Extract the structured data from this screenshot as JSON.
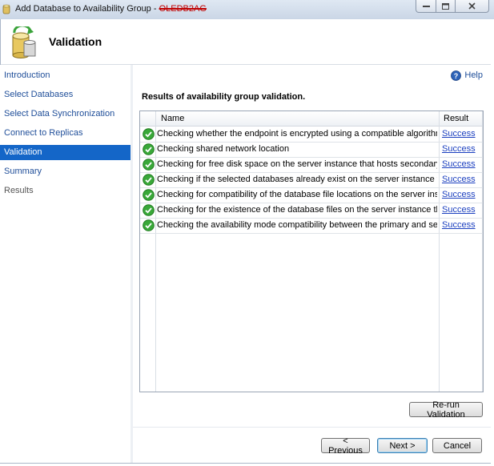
{
  "window": {
    "title": "Add Database to Availability Group - ",
    "title_redacted": "OLEDB2AG",
    "min_icon": "minimize-icon",
    "max_icon": "maximize-icon",
    "close_icon": "close-icon"
  },
  "header": {
    "title": "Validation",
    "icon": "database-wizard-icon"
  },
  "nav": {
    "items": [
      {
        "label": "Introduction",
        "state": "link"
      },
      {
        "label": "Select Databases",
        "state": "link"
      },
      {
        "label": "Select Data Synchronization",
        "state": "link"
      },
      {
        "label": "Connect to Replicas",
        "state": "link"
      },
      {
        "label": "Validation",
        "state": "selected"
      },
      {
        "label": "Summary",
        "state": "link"
      },
      {
        "label": "Results",
        "state": "disabled"
      }
    ]
  },
  "help": {
    "label": "Help",
    "icon": "help-icon"
  },
  "results": {
    "heading": "Results of availability group validation.",
    "columns": {
      "name": "Name",
      "result": "Result"
    },
    "rows": [
      {
        "name": "Checking whether the endpoint is encrypted using a compatible algorithm",
        "result": "Success"
      },
      {
        "name": "Checking shared network location",
        "result": "Success"
      },
      {
        "name": "Checking for free disk space on the server instance that hosts secondary re...",
        "result": "Success"
      },
      {
        "name": "Checking if the selected databases already exist on the server instance that ...",
        "result": "Success"
      },
      {
        "name": "Checking for compatibility of the database file locations on the server insta...",
        "result": "Success"
      },
      {
        "name": "Checking for the existence of the database files on the server instance that ...",
        "result": "Success"
      },
      {
        "name": "Checking the availability mode compatibility between the primary and sec...",
        "result": "Success"
      }
    ],
    "status_icon": "success-check-icon"
  },
  "buttons": {
    "rerun": "Re-run Validation",
    "previous": "< Previous",
    "next": "Next >",
    "cancel": "Cancel"
  },
  "colors": {
    "selected_nav": "#1466c8",
    "link": "#1f4e99",
    "success": "#2e9e2e"
  }
}
